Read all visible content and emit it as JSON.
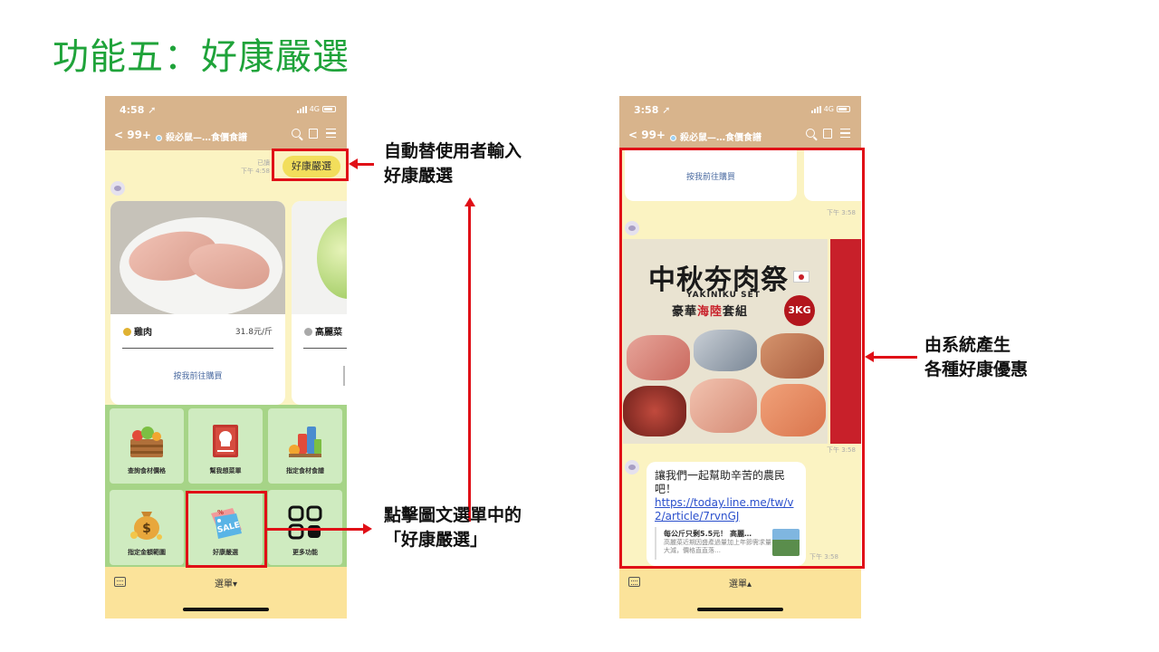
{
  "slide": {
    "title": "功能五：好康嚴選"
  },
  "left_phone": {
    "status": {
      "time": "4:58 ➚",
      "network": "4G"
    },
    "nav": {
      "back": "< 99+",
      "title": "殺必鼠—…食價食譜"
    },
    "sent_message": "好康嚴選",
    "read_meta": {
      "read": "已讀",
      "time": "下午 4:58"
    },
    "card1": {
      "name": "雞肉",
      "price": "31.8元/斤",
      "link": "按我前往購買"
    },
    "card2": {
      "name": "高麗菜"
    },
    "rich_menu": [
      {
        "label": "查詢食材價格"
      },
      {
        "label": "幫我想菜單"
      },
      {
        "label": "指定食材食譜"
      },
      {
        "label": "指定金額範圍"
      },
      {
        "label": "好康嚴選"
      },
      {
        "label": "更多功能"
      }
    ],
    "menu_label": "選單▾"
  },
  "right_phone": {
    "status": {
      "time": "3:58 ➚",
      "network": "4G"
    },
    "nav": {
      "back": "< 99+",
      "title": "殺必鼠—…食價食譜"
    },
    "prev_card_link": "按我前往購買",
    "time_1": "下午 3:58",
    "promo": {
      "title": "中秋夯肉祭",
      "english": "YAKINIKU SET",
      "subtitle_a": "豪華",
      "subtitle_b": "海陸",
      "subtitle_c": "套組",
      "badge": "3KG",
      "flag_text": "JAPAN"
    },
    "time_2": "下午 3:58",
    "reply": {
      "text": "讓我們一起幫助辛苦的農民吧！",
      "url": "https://today.line.me/tw/v2/article/7rvnGJ",
      "preview_title": "每公斤只剩5.5元！ 高麗…",
      "preview_body": "高麗菜近期因盛產過量加上年節需求量大減，價格直直落…"
    },
    "time_3": "下午 3:58",
    "menu_label": "選單▴"
  },
  "annotations": {
    "auto_input_line1": "自動替使用者輸入",
    "auto_input_line2": "好康嚴選",
    "click_menu_line1": "點擊圖文選單中的",
    "click_menu_line2": "「好康嚴選」",
    "system_line1": "由系統產生",
    "system_line2": "各種好康優惠"
  },
  "colors": {
    "title_green": "#1fa33a",
    "header_tan": "#d8b48c",
    "chat_bg": "#fbf3c2",
    "rich_menu_green": "#a6d487",
    "annotation_red": "#e00f17"
  }
}
